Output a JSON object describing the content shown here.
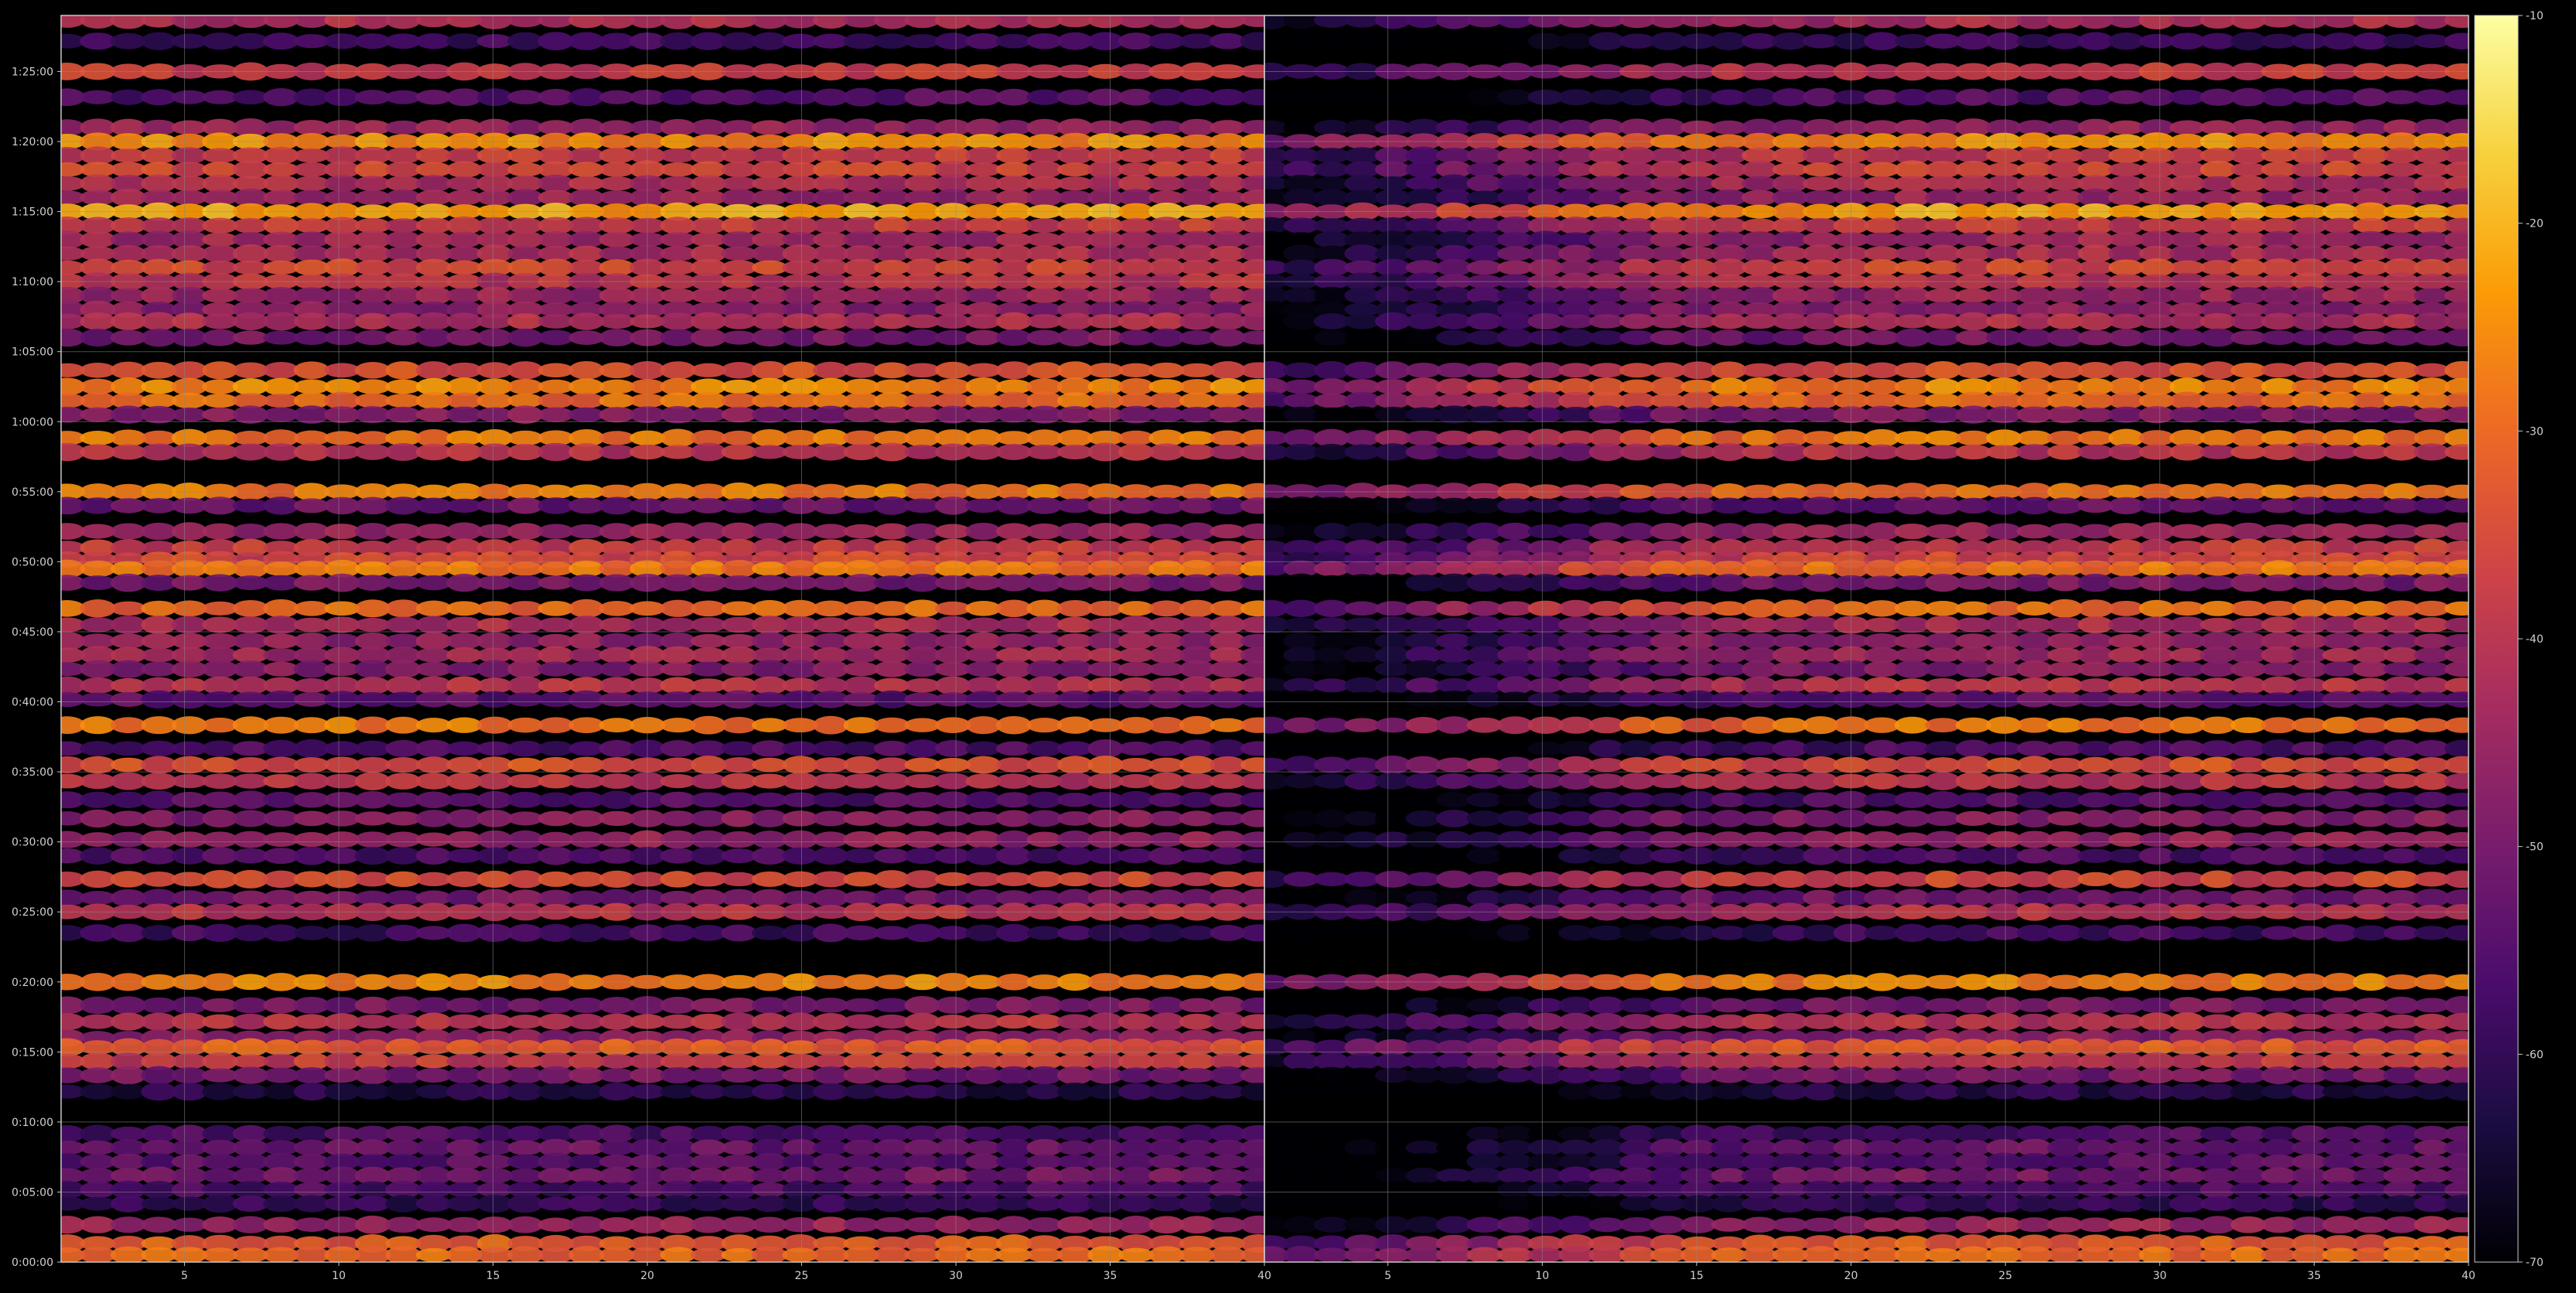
{
  "chart_data": {
    "type": "heatmap",
    "title": "",
    "xlabel": "",
    "ylabel": "",
    "colormap": "inferno",
    "colormap_stops": [
      "#000004",
      "#1b0c41",
      "#4a0c6b",
      "#781c6d",
      "#a52c60",
      "#cf4446",
      "#ed6925",
      "#fb9b06",
      "#f7d13d",
      "#fcffa4"
    ],
    "background_color": "#000000",
    "grid": true,
    "panels": [
      {
        "name": "",
        "xlim": [
          1,
          40
        ],
        "x_ticks": [
          "5",
          "10",
          "15",
          "20",
          "25",
          "30",
          "35",
          "40"
        ],
        "character": "intensity high across all columns 1–40"
      },
      {
        "name": "",
        "xlim": [
          1,
          40
        ],
        "x_ticks": [
          "5",
          "10",
          "15",
          "20",
          "25",
          "30",
          "35",
          "40"
        ],
        "character": "weak for columns 1–15, intensity increases toward column 40"
      }
    ],
    "y_range_seconds": [
      0,
      5340
    ],
    "y_ticks": [
      "0:00:00",
      "0:05:00",
      "0:10:00",
      "0:15:00",
      "0:20:00",
      "0:25:00",
      "0:30:00",
      "0:35:00",
      "0:40:00",
      "0:45:00",
      "0:50:00",
      "0:55:00",
      "1:00:00",
      "1:05:00",
      "1:10:00",
      "1:15:00",
      "1:20:00",
      "1:25:00"
    ],
    "colorbar": {
      "range": [
        -70,
        -10
      ],
      "ticks": [
        "-10",
        "-20",
        "-30",
        "-40",
        "-50",
        "-60",
        "-70"
      ]
    },
    "band_levels": [
      {
        "t": "1:28:40",
        "v": -42
      },
      {
        "t": "1:27:10",
        "v": -58
      },
      {
        "t": "1:25:00",
        "v": -38
      },
      {
        "t": "1:23:10",
        "v": -55
      },
      {
        "t": "1:21:00",
        "v": -45
      },
      {
        "t": "1:20:00",
        "v": -25
      },
      {
        "t": "1:19:00",
        "v": -38
      },
      {
        "t": "1:18:00",
        "v": -36
      },
      {
        "t": "1:17:00",
        "v": -42
      },
      {
        "t": "1:16:00",
        "v": -45
      },
      {
        "t": "1:15:00",
        "v": -22
      },
      {
        "t": "1:14:00",
        "v": -38
      },
      {
        "t": "1:13:00",
        "v": -44
      },
      {
        "t": "1:12:00",
        "v": -42
      },
      {
        "t": "1:11:00",
        "v": -36
      },
      {
        "t": "1:10:00",
        "v": -40
      },
      {
        "t": "1:09:00",
        "v": -45
      },
      {
        "t": "1:08:00",
        "v": -47
      },
      {
        "t": "1:07:10",
        "v": -42
      },
      {
        "t": "1:06:00",
        "v": -50
      },
      {
        "t": "1:03:40",
        "v": -34
      },
      {
        "t": "1:02:30",
        "v": -26
      },
      {
        "t": "1:01:30",
        "v": -30
      },
      {
        "t": "1:00:30",
        "v": -48
      },
      {
        "t": "0:58:50",
        "v": -28
      },
      {
        "t": "0:57:50",
        "v": -40
      },
      {
        "t": "0:55:00",
        "v": -28
      },
      {
        "t": "0:54:00",
        "v": -52
      },
      {
        "t": "0:52:10",
        "v": -45
      },
      {
        "t": "0:51:00",
        "v": -38
      },
      {
        "t": "0:50:10",
        "v": -36
      },
      {
        "t": "0:49:30",
        "v": -28
      },
      {
        "t": "0:48:30",
        "v": -50
      },
      {
        "t": "0:46:40",
        "v": -30
      },
      {
        "t": "0:45:30",
        "v": -42
      },
      {
        "t": "0:44:20",
        "v": -46
      },
      {
        "t": "0:43:20",
        "v": -44
      },
      {
        "t": "0:42:20",
        "v": -48
      },
      {
        "t": "0:41:10",
        "v": -40
      },
      {
        "t": "0:40:10",
        "v": -54
      },
      {
        "t": "0:38:20",
        "v": -28
      },
      {
        "t": "0:36:40",
        "v": -56
      },
      {
        "t": "0:35:30",
        "v": -34
      },
      {
        "t": "0:34:20",
        "v": -40
      },
      {
        "t": "0:33:00",
        "v": -55
      },
      {
        "t": "0:31:40",
        "v": -48
      },
      {
        "t": "0:30:10",
        "v": -46
      },
      {
        "t": "0:29:00",
        "v": -56
      },
      {
        "t": "0:27:20",
        "v": -36
      },
      {
        "t": "0:26:00",
        "v": -50
      },
      {
        "t": "0:25:00",
        "v": -40
      },
      {
        "t": "0:23:30",
        "v": -58
      },
      {
        "t": "0:20:00",
        "v": -26
      },
      {
        "t": "0:18:20",
        "v": -50
      },
      {
        "t": "0:17:10",
        "v": -40
      },
      {
        "t": "0:16:00",
        "v": -47
      },
      {
        "t": "0:15:20",
        "v": -32
      },
      {
        "t": "0:14:20",
        "v": -38
      },
      {
        "t": "0:13:20",
        "v": -50
      },
      {
        "t": "0:12:10",
        "v": -62
      },
      {
        "t": "0:09:10",
        "v": -56
      },
      {
        "t": "0:08:10",
        "v": -52
      },
      {
        "t": "0:07:10",
        "v": -54
      },
      {
        "t": "0:06:10",
        "v": -50
      },
      {
        "t": "0:05:10",
        "v": -56
      },
      {
        "t": "0:04:10",
        "v": -60
      },
      {
        "t": "0:02:40",
        "v": -45
      },
      {
        "t": "0:01:20",
        "v": -32
      },
      {
        "t": "0:00:30",
        "v": -30
      }
    ]
  }
}
